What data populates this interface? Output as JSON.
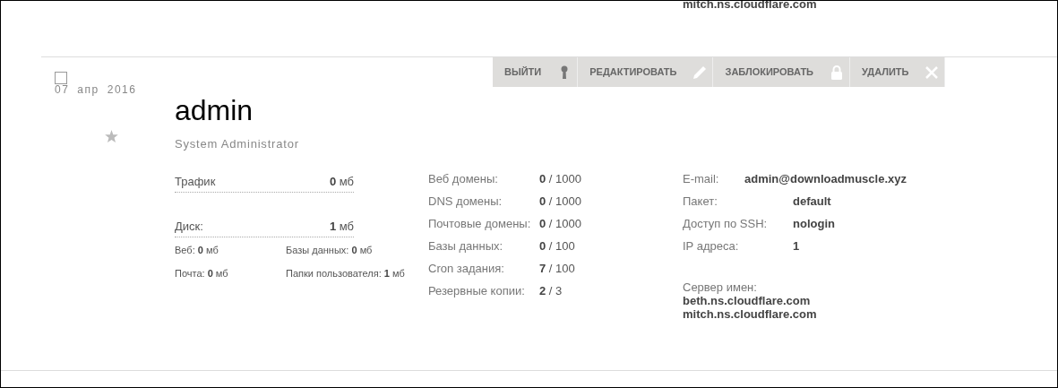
{
  "top_cut_text": "mitch.ns.cloudflare.com",
  "user": {
    "checked": false,
    "date": [
      "07",
      "апр",
      "2016"
    ],
    "name": "admin",
    "role": "System Administrator",
    "starred": false
  },
  "actions": [
    {
      "label": "ВЫЙТИ",
      "kind": "key"
    },
    {
      "label": "РЕДАКТИРОВАТЬ",
      "kind": "edit"
    },
    {
      "label": "ЗАБЛОКИРОВАТЬ",
      "kind": "lock"
    },
    {
      "label": "УДАЛИТЬ",
      "kind": "delete"
    }
  ],
  "usage": [
    {
      "label": "Трафик",
      "value": "0",
      "unit": "мб"
    },
    {
      "label": "Диск:",
      "value": "1",
      "unit": "мб"
    }
  ],
  "disk_details": [
    {
      "label": "Веб:",
      "value": "0",
      "unit": "мб"
    },
    {
      "label": "Базы данных:",
      "value": "0",
      "unit": "мб"
    },
    {
      "label": "Почта:",
      "value": "0",
      "unit": "мб"
    },
    {
      "label": "Папки пользователя:",
      "value": "1",
      "unit": "мб"
    }
  ],
  "limits": [
    {
      "label": "Веб домены:",
      "used": "0",
      "total": "/ 1000"
    },
    {
      "label": "DNS домены:",
      "used": "0",
      "total": "/ 1000"
    },
    {
      "label": "Почтовые домены:",
      "used": "0",
      "total": "/ 1000"
    },
    {
      "label": "Базы данных:",
      "used": "0",
      "total": "/ 100"
    },
    {
      "label": "Cron задания:",
      "used": "7",
      "total": "/ 100"
    },
    {
      "label": "Резервные копии:",
      "used": "2",
      "total": "/ 3"
    }
  ],
  "info": [
    {
      "label": "E-mail:",
      "value": "admin@downloadmuscle.xyz"
    },
    {
      "label": "Пакет:",
      "value": "default"
    },
    {
      "label": "Доступ по SSH:",
      "value": "nologin"
    },
    {
      "label": "IP адреса:",
      "value": "1"
    }
  ],
  "name_servers": {
    "label": "Сервер имен:",
    "servers": [
      "beth.ns.cloudflare.com",
      "mitch.ns.cloudflare.com"
    ]
  }
}
